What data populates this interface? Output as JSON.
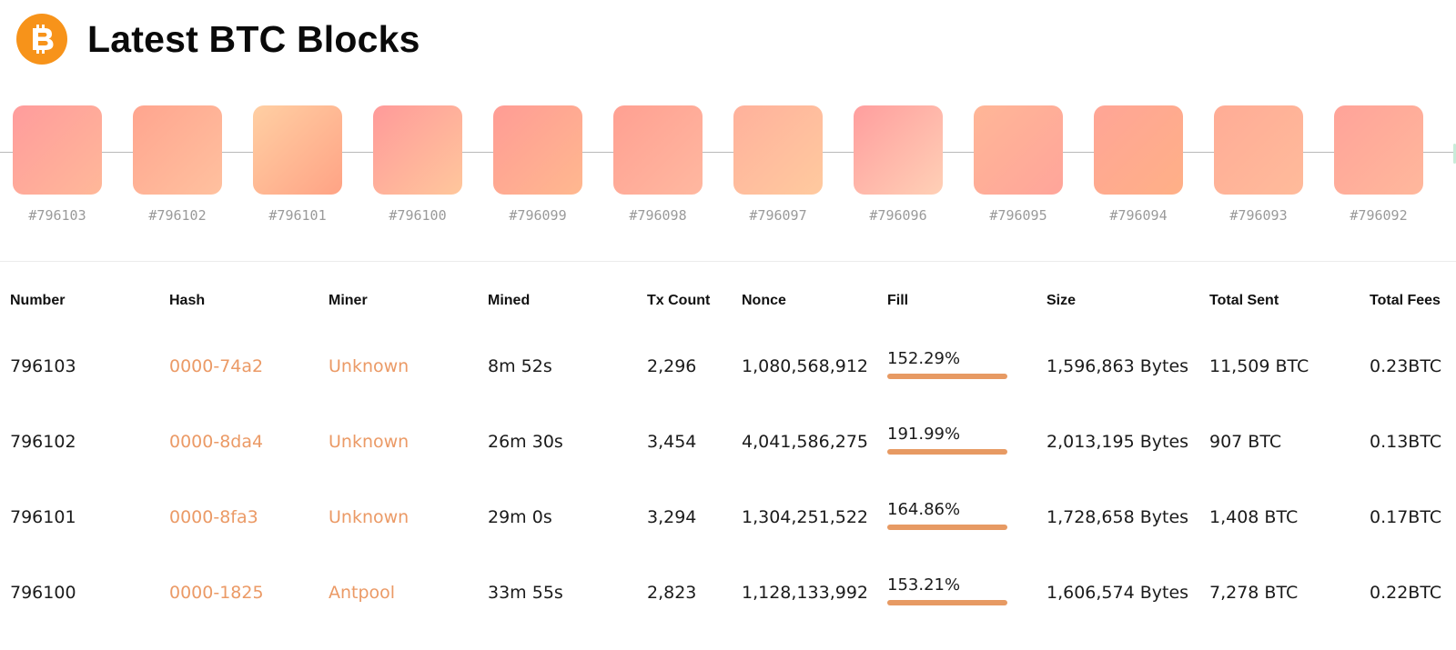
{
  "header": {
    "title": "Latest BTC Blocks",
    "logo_icon": "bitcoin-icon",
    "logo_color": "#f7931a"
  },
  "chain": {
    "blocks": [
      {
        "label": "#796103",
        "gradient": [
          "#ff9c9c",
          "#ffb899"
        ]
      },
      {
        "label": "#796102",
        "gradient": [
          "#ffa58f",
          "#ffc19f"
        ]
      },
      {
        "label": "#796101",
        "gradient": [
          "#ffcfa3",
          "#ffa385"
        ]
      },
      {
        "label": "#796100",
        "gradient": [
          "#ff9a9a",
          "#ffc79c"
        ]
      },
      {
        "label": "#796099",
        "gradient": [
          "#ff9c95",
          "#ffb88f"
        ]
      },
      {
        "label": "#796098",
        "gradient": [
          "#ffa092",
          "#ffb8a0"
        ]
      },
      {
        "label": "#796097",
        "gradient": [
          "#ffb19c",
          "#ffca9f"
        ]
      },
      {
        "label": "#796096",
        "gradient": [
          "#ff9e9e",
          "#ffd0b6"
        ]
      },
      {
        "label": "#796095",
        "gradient": [
          "#ffb697",
          "#ffa59a"
        ]
      },
      {
        "label": "#796094",
        "gradient": [
          "#ffa596",
          "#ffb087"
        ]
      },
      {
        "label": "#796093",
        "gradient": [
          "#ffac96",
          "#ffbb9b"
        ]
      },
      {
        "label": "#796092",
        "gradient": [
          "#ffa399",
          "#ffb89c"
        ]
      }
    ]
  },
  "table": {
    "headers": {
      "number": "Number",
      "hash": "Hash",
      "miner": "Miner",
      "mined": "Mined",
      "tx_count": "Tx Count",
      "nonce": "Nonce",
      "fill": "Fill",
      "size": "Size",
      "total_sent": "Total Sent",
      "total_fees": "Total Fees"
    },
    "rows": [
      {
        "number": "796103",
        "hash": "0000-74a2",
        "miner": "Unknown",
        "mined": "8m 52s",
        "tx_count": "2,296",
        "nonce": "1,080,568,912",
        "fill": "152.29%",
        "size": "1,596,863 Bytes",
        "total_sent": "11,509 BTC",
        "total_fees": "0.23BTC"
      },
      {
        "number": "796102",
        "hash": "0000-8da4",
        "miner": "Unknown",
        "mined": "26m 30s",
        "tx_count": "3,454",
        "nonce": "4,041,586,275",
        "fill": "191.99%",
        "size": "2,013,195 Bytes",
        "total_sent": "907 BTC",
        "total_fees": "0.13BTC"
      },
      {
        "number": "796101",
        "hash": "0000-8fa3",
        "miner": "Unknown",
        "mined": "29m 0s",
        "tx_count": "3,294",
        "nonce": "1,304,251,522",
        "fill": "164.86%",
        "size": "1,728,658 Bytes",
        "total_sent": "1,408 BTC",
        "total_fees": "0.17BTC"
      },
      {
        "number": "796100",
        "hash": "0000-1825",
        "miner": "Antpool",
        "mined": "33m 55s",
        "tx_count": "2,823",
        "nonce": "1,128,133,992",
        "fill": "153.21%",
        "size": "1,606,574 Bytes",
        "total_sent": "7,278 BTC",
        "total_fees": "0.22BTC"
      }
    ]
  },
  "colors": {
    "accent": "#eb9a66",
    "fill_bar": "#e79a63"
  }
}
